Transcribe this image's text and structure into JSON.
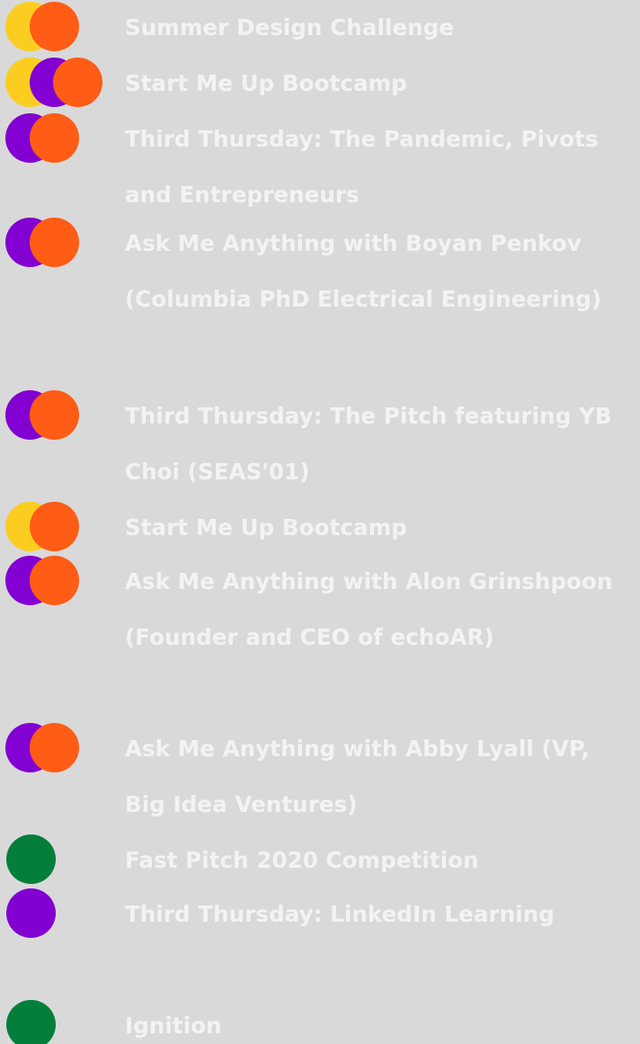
{
  "colors": {
    "background": "#d9d9d9",
    "text": "#f3f3f3",
    "yellow": "#fccd21",
    "purple": "#8200d1",
    "orange": "#ff5c16",
    "green": "#047f3b"
  },
  "events": [
    {
      "title": "Summer Design Challenge",
      "dots": [
        "yellow",
        "orange"
      ]
    },
    {
      "title": "Start Me Up Bootcamp",
      "dots": [
        "yellow",
        "purple",
        "orange"
      ]
    },
    {
      "title": "Third Thursday: The Pandemic, Pivots and Entrepreneurs",
      "dots": [
        "purple",
        "orange"
      ]
    },
    {
      "title": "Ask Me Anything with Boyan Penkov (Columbia PhD Electrical Engineering)",
      "dots": [
        "purple",
        "orange"
      ]
    },
    {
      "title": "Third Thursday: The Pitch featuring YB Choi (SEAS'01)",
      "dots": [
        "purple",
        "orange"
      ]
    },
    {
      "title": "Start Me Up Bootcamp",
      "dots": [
        "yellow",
        "orange"
      ]
    },
    {
      "title": "Ask Me Anything with Alon Grinshpoon (Founder and CEO of echoAR)",
      "dots": [
        "purple",
        "orange"
      ]
    },
    {
      "title": "Ask Me Anything with Abby Lyall (VP, Big Idea Ventures)",
      "dots": [
        "purple",
        "orange"
      ]
    },
    {
      "title": "Fast Pitch 2020 Competition",
      "dots": [
        "green"
      ]
    },
    {
      "title": "Third Thursday: LinkedIn Learning",
      "dots": [
        "purple"
      ]
    },
    {
      "title": "Ignition",
      "dots": [
        "green"
      ]
    }
  ]
}
